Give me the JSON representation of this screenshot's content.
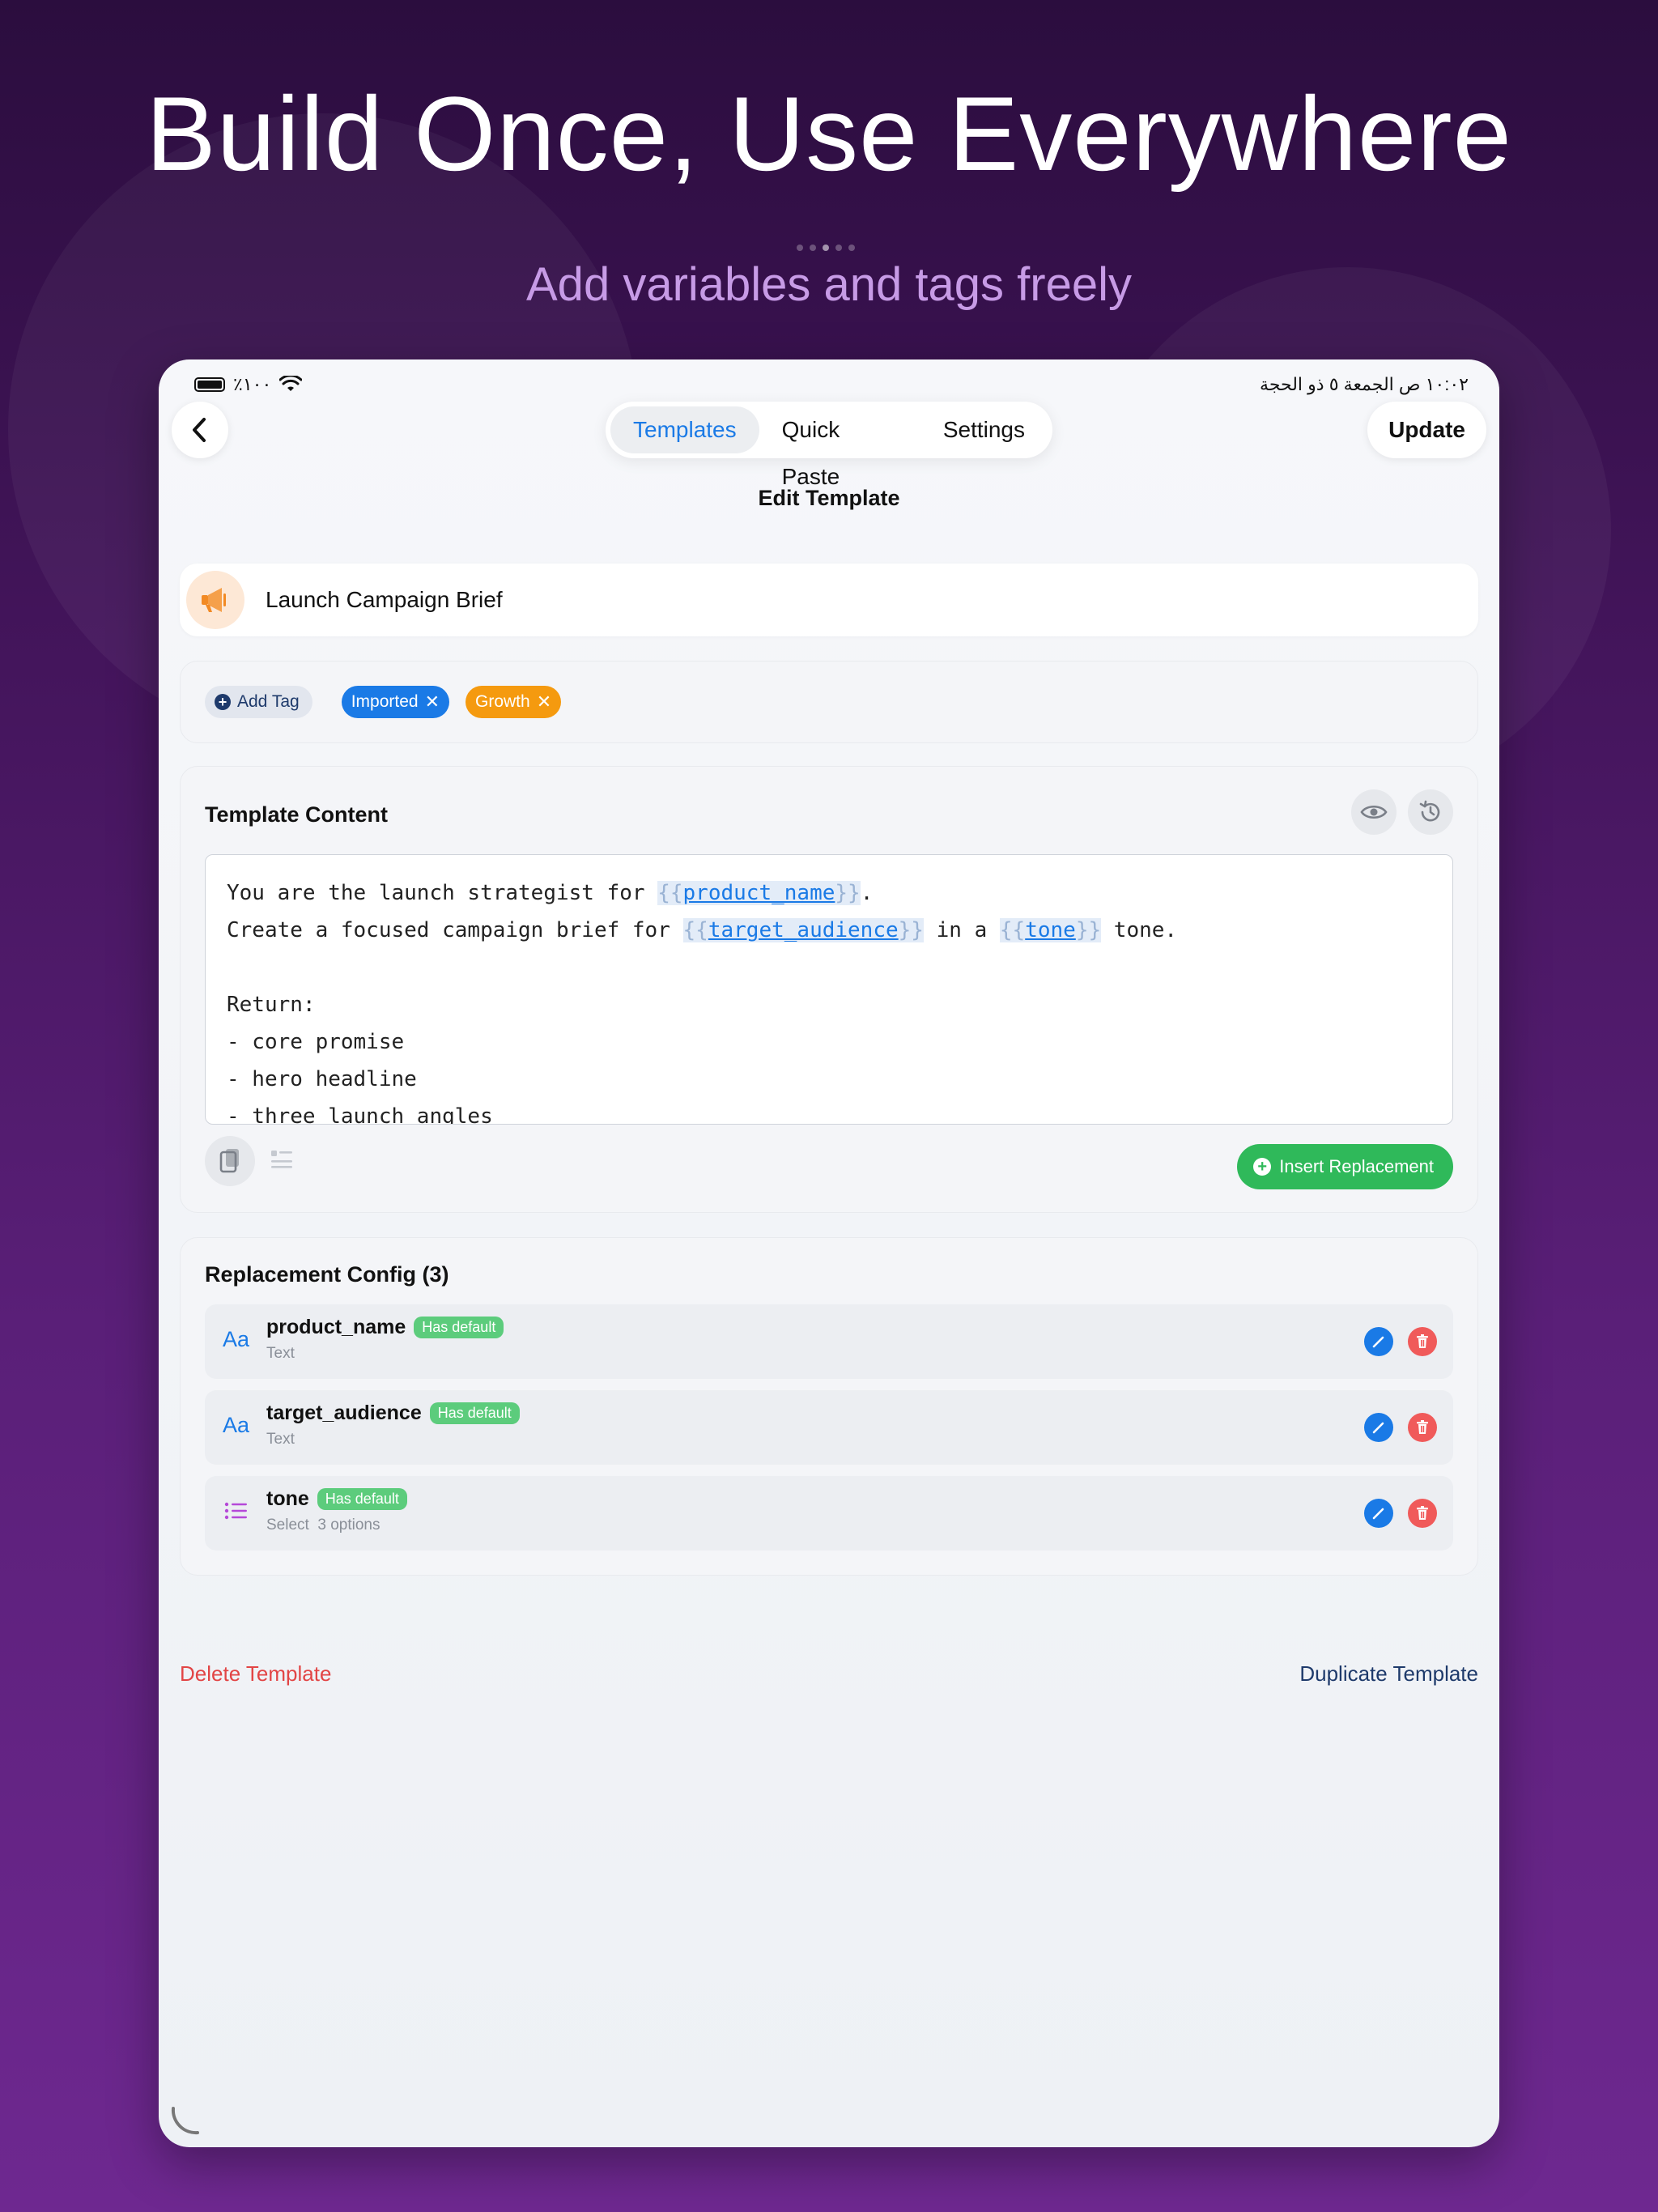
{
  "hero": {
    "title": "Build Once, Use Everywhere",
    "subtitle": "Add variables and tags freely"
  },
  "status_bar": {
    "battery": "٪١٠٠",
    "datetime": "١٠:٠٢ ص   الجمعة ٥ ذو الحجة"
  },
  "nav": {
    "tabs": [
      {
        "label": "Templates",
        "active": true
      },
      {
        "label": "Quick Paste",
        "active": false
      },
      {
        "label": "Settings",
        "active": false
      }
    ],
    "update_label": "Update",
    "screen_title": "Edit Template"
  },
  "template": {
    "name": "Launch Campaign Brief"
  },
  "tags": {
    "add_label": "Add Tag",
    "items": [
      {
        "label": "Imported",
        "color": "#1a7ae6"
      },
      {
        "label": "Growth",
        "color": "#f59a0f"
      }
    ]
  },
  "content": {
    "title": "Template Content",
    "lines": {
      "l1_pre": "You are the launch strategist for ",
      "l1_var": "product_name",
      "l1_post": ".",
      "l2_pre": "Create a focused campaign brief for ",
      "l2_var1": "target_audience",
      "l2_mid": " in a ",
      "l2_var2": "tone",
      "l2_post": " tone.",
      "l4": "Return:",
      "l5": "- core promise",
      "l6": "- hero headline",
      "l7": "- three launch angles"
    },
    "brace_open": "{{",
    "brace_close": "}}",
    "insert_label": "Insert Replacement"
  },
  "config": {
    "title": "Replacement Config (3)",
    "items": [
      {
        "name": "product_name",
        "badge": "Has default",
        "type": "Text",
        "extra": "",
        "icon": "text-type-icon"
      },
      {
        "name": "target_audience",
        "badge": "Has default",
        "type": "Text",
        "extra": "",
        "icon": "text-type-icon"
      },
      {
        "name": "tone",
        "badge": "Has default",
        "type": "Select",
        "extra": "3 options",
        "icon": "list-type-icon"
      }
    ],
    "text_icon_glyph": "Aa"
  },
  "footer": {
    "delete_label": "Delete Template",
    "duplicate_label": "Duplicate Template"
  },
  "colors": {
    "accent": "#1a7ae6",
    "success": "#2fb95a",
    "danger": "#e24545",
    "badge": "#5ccc7c"
  }
}
